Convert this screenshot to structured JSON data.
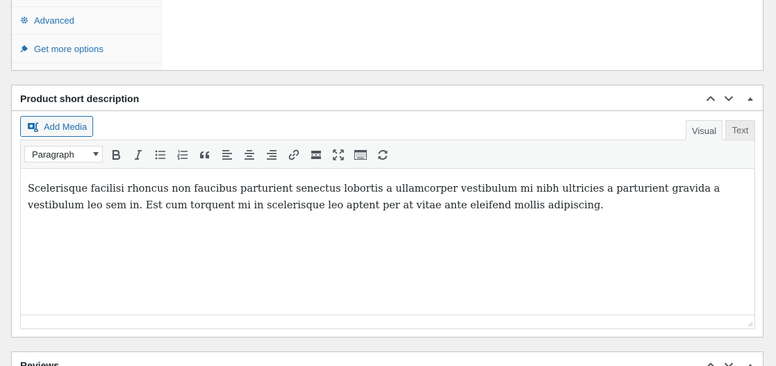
{
  "product_data_tabs": {
    "items": [
      {
        "label": "Advanced",
        "icon": "gear-icon"
      },
      {
        "label": "Get more options",
        "icon": "plugin-icon"
      }
    ]
  },
  "short_description": {
    "title": "Product short description",
    "add_media_label": "Add Media",
    "mode_tabs": {
      "visual": "Visual",
      "text": "Text"
    },
    "format_select": "Paragraph",
    "toolbar_icons": [
      "bold-icon",
      "italic-icon",
      "bulleted-list-icon",
      "numbered-list-icon",
      "blockquote-icon",
      "align-left-icon",
      "align-center-icon",
      "align-right-icon",
      "link-icon",
      "read-more-icon",
      "fullscreen-icon",
      "toolbar-toggle-icon",
      "refresh-icon"
    ],
    "content": "Scelerisque facilisi rhoncus non faucibus parturient senectus lobortis a ullamcorper vestibulum mi nibh ultricies a parturient gravida a vestibulum leo sem in. Est cum torquent mi in scelerisque leo aptent per at vitae ante eleifend mollis adipiscing."
  },
  "reviews": {
    "title": "Reviews"
  },
  "colors": {
    "accent": "#2271b1",
    "border": "#c3c4c7",
    "background": "#f0f0f1"
  }
}
